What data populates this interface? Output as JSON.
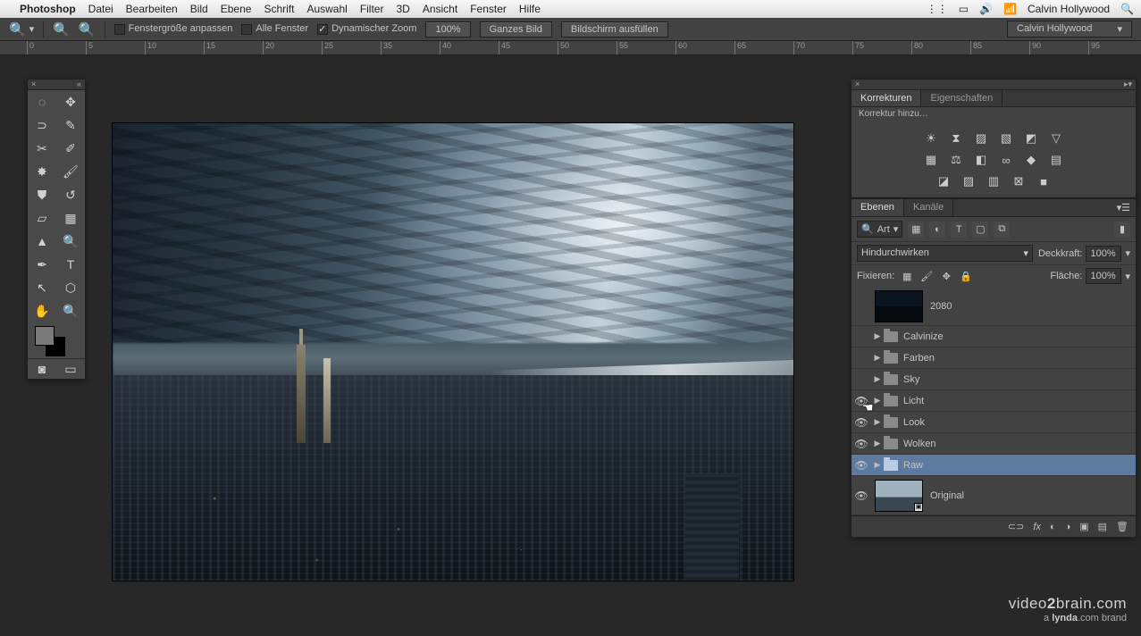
{
  "mac_menu": {
    "apple": "",
    "app": "Photoshop",
    "items": [
      "Datei",
      "Bearbeiten",
      "Bild",
      "Ebene",
      "Schrift",
      "Auswahl",
      "Filter",
      "3D",
      "Ansicht",
      "Fenster",
      "Hilfe"
    ],
    "right_user": "Calvin Hollywood"
  },
  "options_bar": {
    "chk1": "Fenstergröße anpassen",
    "chk2": "Alle Fenster",
    "chk3": "Dynamischer Zoom",
    "zoom_pct": "100%",
    "btn_fit": "Ganzes Bild",
    "btn_fill": "Bildschirm ausfüllen",
    "workspace": "Calvin Hollywood"
  },
  "ruler_ticks": [
    "0",
    "5",
    "10",
    "15",
    "20",
    "25",
    "35",
    "40",
    "45",
    "50",
    "55",
    "60",
    "65",
    "70",
    "75",
    "80",
    "85",
    "90",
    "95"
  ],
  "panels": {
    "adjustments": {
      "tab1": "Korrekturen",
      "tab2": "Eigenschaften",
      "add_label": "Korrektur hinzu…",
      "row1": [
        "☀",
        "⧗",
        "▨",
        "▧",
        "◩",
        "▽"
      ],
      "row2": [
        "▦",
        "⚖",
        "◧",
        "∞",
        "◆",
        "▤"
      ],
      "row3": [
        "◪",
        "▨",
        "▥",
        "⊠",
        "■"
      ]
    },
    "layers": {
      "tab1": "Ebenen",
      "tab2": "Kanäle",
      "filter_label": "Art",
      "blend_mode": "Hindurchwirken",
      "opacity_label": "Deckkraft:",
      "opacity_val": "100%",
      "lock_label": "Fixieren:",
      "fill_label": "Fläche:",
      "fill_val": "100%",
      "items": [
        {
          "name": "2080",
          "type": "thumb",
          "visible": false,
          "thumb": "dark"
        },
        {
          "name": "Calvinize",
          "type": "folder",
          "visible": false
        },
        {
          "name": "Farben",
          "type": "folder",
          "visible": false
        },
        {
          "name": "Sky",
          "type": "folder",
          "visible": false
        },
        {
          "name": "Licht",
          "type": "folder",
          "visible": true
        },
        {
          "name": "Look",
          "type": "folder",
          "visible": true
        },
        {
          "name": "Wolken",
          "type": "folder",
          "visible": true
        },
        {
          "name": "Raw",
          "type": "folder",
          "visible": true,
          "selected": true
        },
        {
          "name": "Original",
          "type": "thumb",
          "visible": true,
          "thumb": "lite"
        }
      ]
    }
  },
  "watermark": {
    "line1a": "video",
    "line1b": "2",
    "line1c": "brain",
    "line1d": ".com",
    "line2a": "a ",
    "line2b": "lynda",
    "line2c": ".com brand"
  }
}
